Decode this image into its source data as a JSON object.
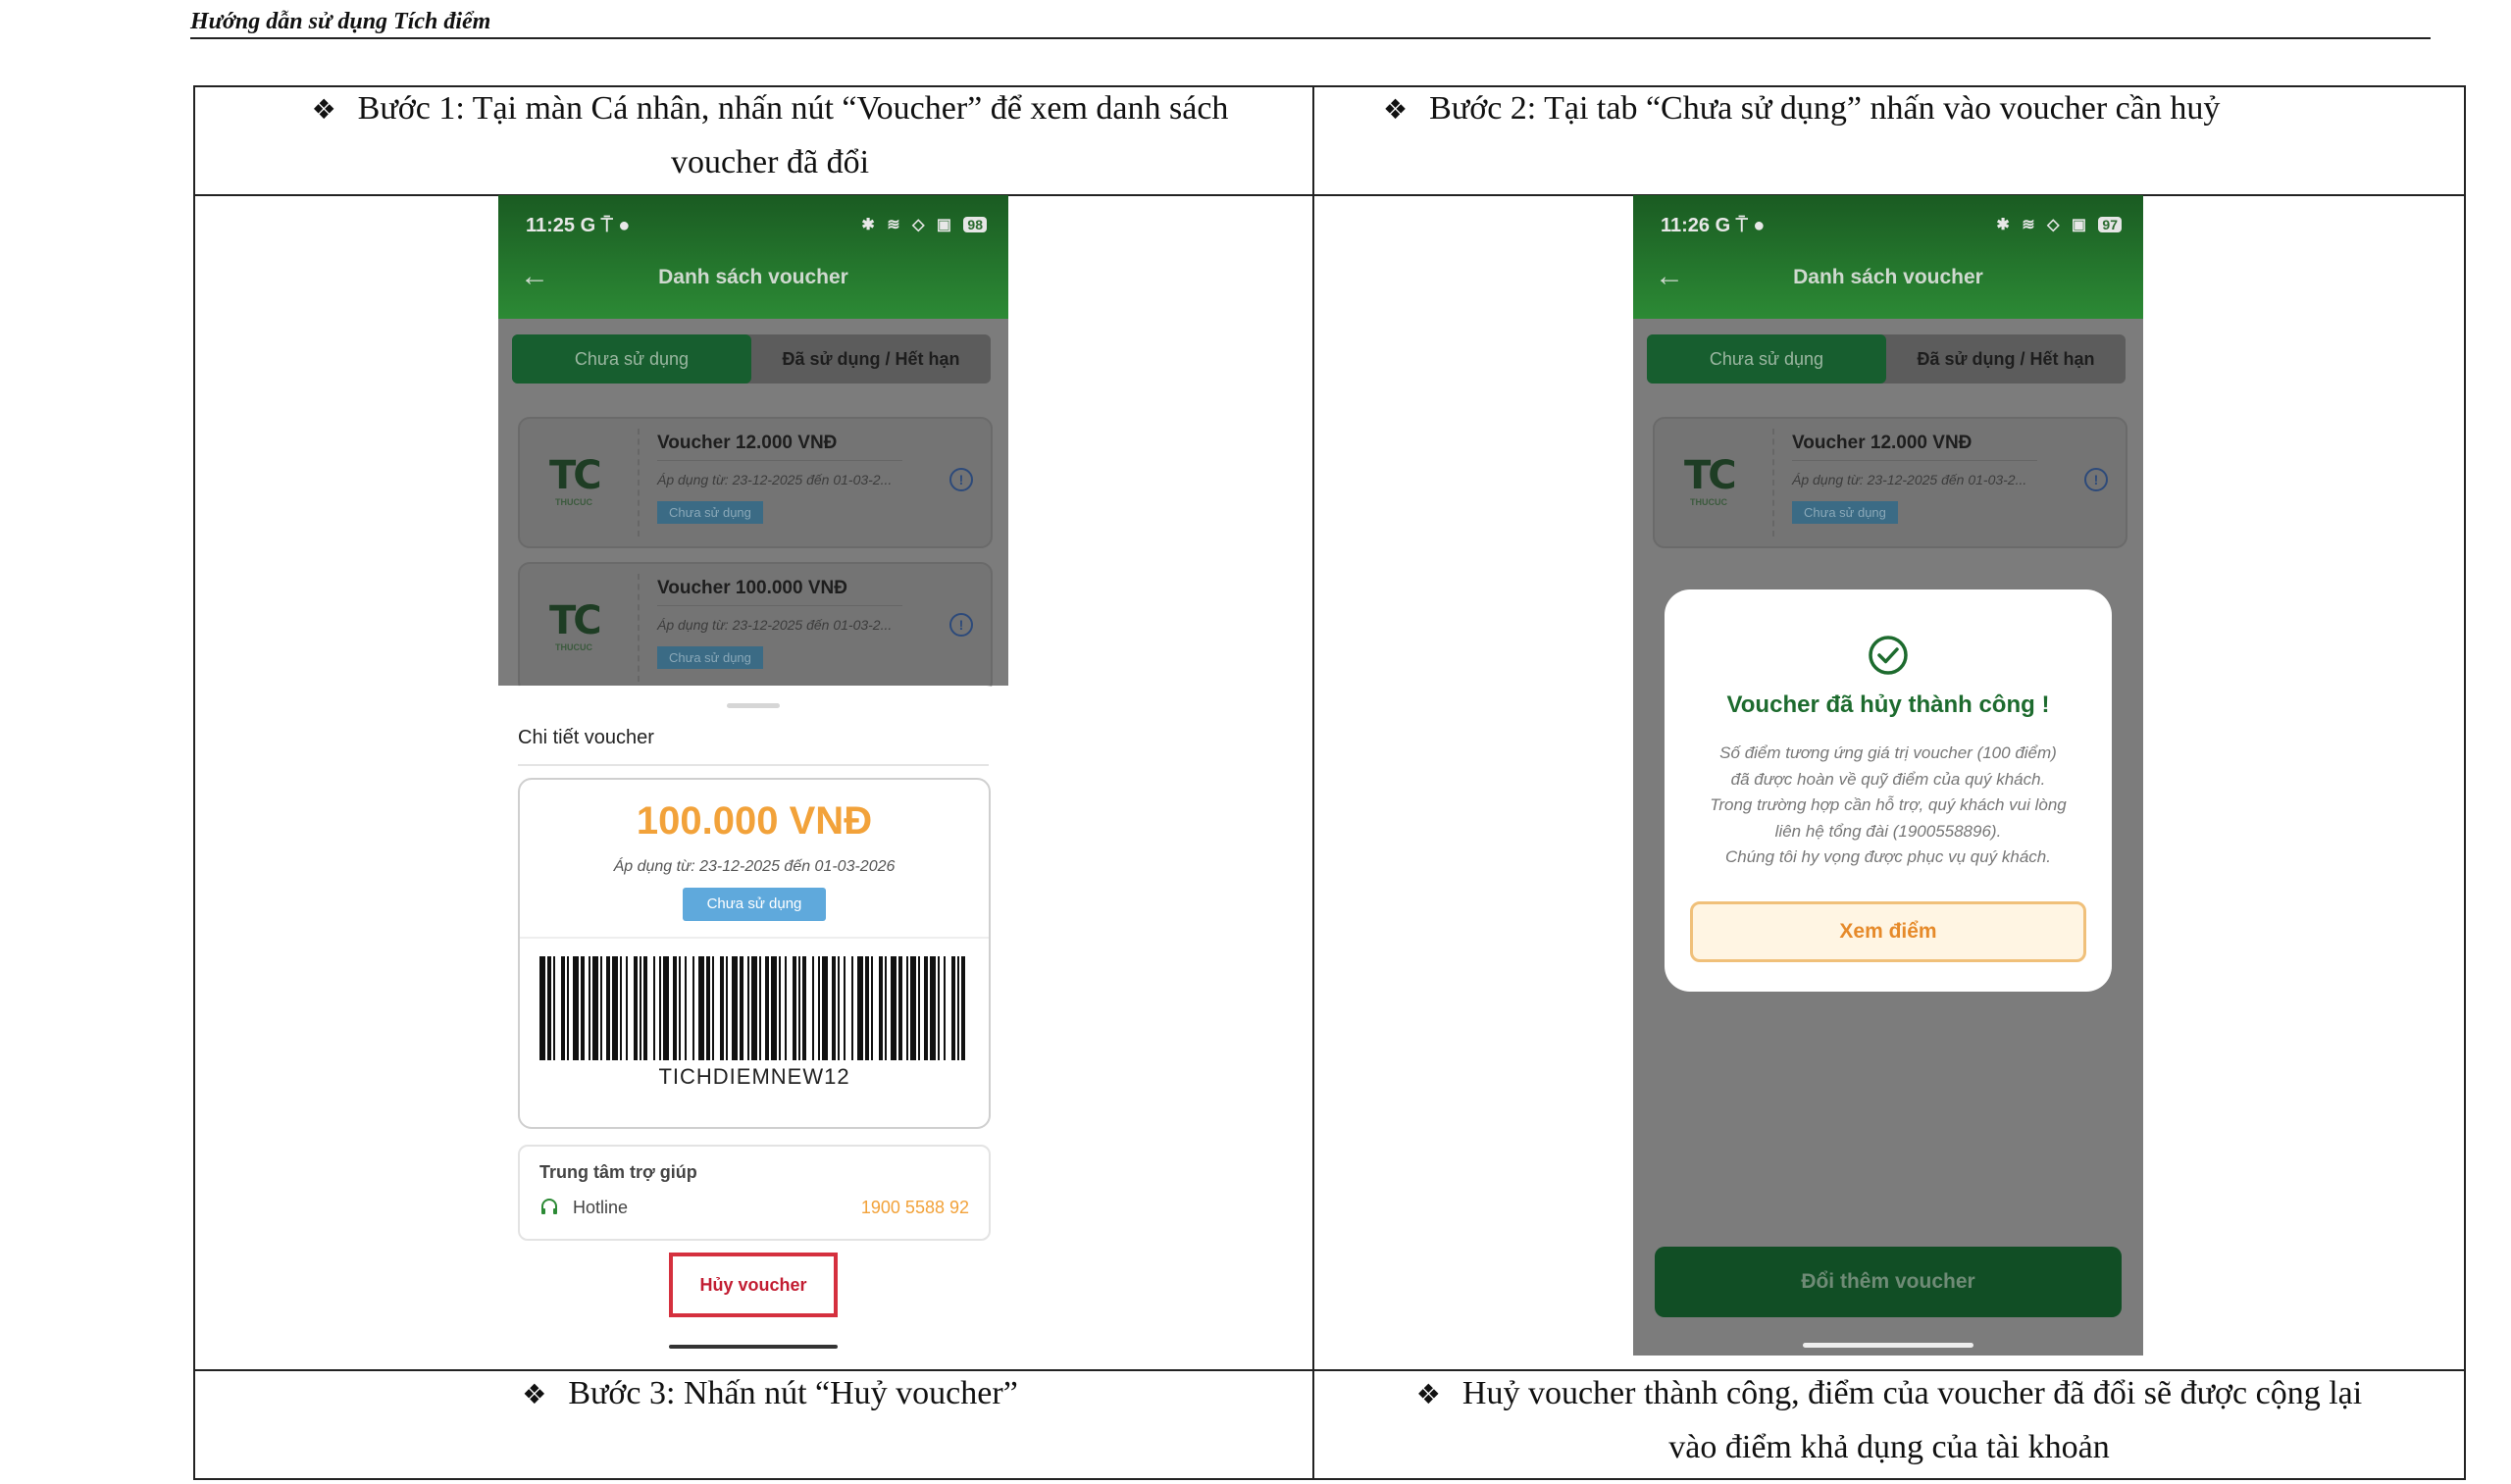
{
  "header": {
    "title": "Hướng dẫn sử dụng Tích điểm"
  },
  "captions": {
    "step1": {
      "line1": "Bước 1: Tại màn Cá nhân, nhấn nút “Voucher” để xem danh sách",
      "line2": "voucher đã đổi"
    },
    "step2": {
      "line1": "Bước 2: Tại tab “Chưa sử dụng” nhấn vào voucher cần huỷ"
    },
    "step3": {
      "line1": "Bước 3: Nhấn nút “Huỷ voucher”"
    },
    "step4": {
      "line1": "Huỷ voucher thành công, điểm của voucher đã đổi sẽ được cộng lại",
      "line2": "vào điểm khả dụng của tài khoản"
    }
  },
  "phone_a": {
    "status_time": "11:25 G ⍑ ●",
    "status_icons": "✱ ≋ ◇ ▣",
    "battery": "98",
    "appbar_title": "Danh sách voucher",
    "tab_unused": "Chưa sử dụng",
    "tab_used": "Đã sử dụng / Hết hạn",
    "vouchers": [
      {
        "logo": "TC",
        "logo_sub": "THUCUC",
        "title": "Voucher 12.000 VNĐ",
        "date": "Áp dụng từ: 23-12-2025 đến 01-03-2...",
        "badge": "Chưa sử dụng",
        "info": "!"
      },
      {
        "logo": "TC",
        "logo_sub": "THUCUC",
        "title": "Voucher 100.000 VNĐ",
        "date": "Áp dụng từ: 23-12-2025 đến 01-03-2...",
        "badge": "Chưa sử dụng",
        "info": "!"
      }
    ],
    "sheet_title": "Chi tiết voucher",
    "amount": "100.000 VNĐ",
    "detail_date": "Áp dụng từ: 23-12-2025 đến 01-03-2026",
    "detail_badge": "Chưa sử dụng",
    "barcode_code": "TICHDIEMNEW12",
    "help_title": "Trung tâm trợ giúp",
    "hotline_label": "Hotline",
    "hotline_number": "1900 5588 92",
    "cancel_button": "Hủy voucher"
  },
  "phone_b": {
    "status_time": "11:26 G ⍑ ●",
    "status_icons": "✱ ≋ ◇ ▣",
    "battery": "97",
    "appbar_title": "Danh sách voucher",
    "tab_unused": "Chưa sử dụng",
    "tab_used": "Đã sử dụng / Hết hạn",
    "voucher": {
      "logo": "TC",
      "logo_sub": "THUCUC",
      "title": "Voucher 12.000 VNĐ",
      "date": "Áp dụng từ: 23-12-2025 đến 01-03-2...",
      "badge": "Chưa sử dụng",
      "info": "!"
    },
    "dialog_title": "Voucher đã hủy thành công !",
    "dialog_body": [
      "Số điểm tương ứng giá trị voucher (100 điểm)",
      "đã được hoàn về quỹ điểm của quý khách.",
      "Trong trường hợp cần hỗ trợ, quý khách vui lòng",
      "liên hệ tổng đài (1900558896).",
      "Chúng tôi hy vọng được phục vụ quý khách."
    ],
    "dialog_button": "Xem điểm",
    "bottom_button": "Đổi thêm voucher"
  },
  "colors": {
    "brand_green": "#2c8a35",
    "accent_orange": "#f2a23a",
    "cancel_red": "#d5303e",
    "badge_blue": "#5fa9dc"
  },
  "icons": {
    "bullet": "diamond-bullet-icon",
    "back": "back-arrow-icon",
    "info": "info-icon",
    "headset": "headset-icon",
    "check": "check-circle-icon"
  }
}
